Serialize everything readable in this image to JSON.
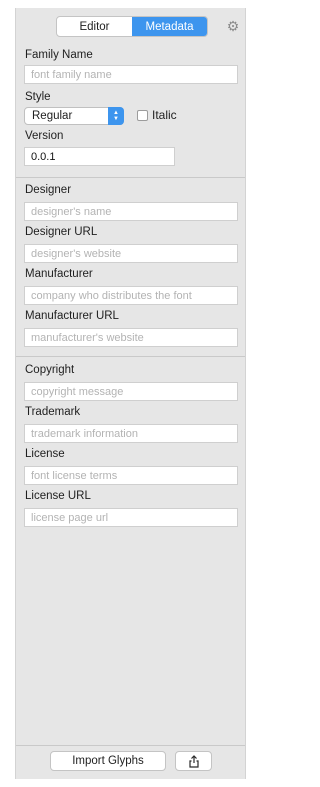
{
  "tabs": [
    {
      "label": "Editor",
      "active": false
    },
    {
      "label": "Metadata",
      "active": true
    }
  ],
  "icons": {
    "settings": "gear-icon",
    "export": "share-icon",
    "stepper": "chevron-updown-icon"
  },
  "colors": {
    "accent": "#3d95ee",
    "panel": "#e6e6e6"
  },
  "fields": {
    "family_name": {
      "label": "Family Name",
      "placeholder": "font family name"
    },
    "style": {
      "label": "Style",
      "value": "Regular",
      "italic_label": "Italic",
      "italic_checked": false
    },
    "version": {
      "label": "Version",
      "value": "0.0.1"
    },
    "designer": {
      "label": "Designer",
      "placeholder": "designer's name"
    },
    "designer_url": {
      "label": "Designer URL",
      "placeholder": "designer's website"
    },
    "manufacturer": {
      "label": "Manufacturer",
      "placeholder": "company who distributes the font"
    },
    "manufacturer_url": {
      "label": "Manufacturer URL",
      "placeholder": "manufacturer's website"
    },
    "copyright": {
      "label": "Copyright",
      "placeholder": "copyright message"
    },
    "trademark": {
      "label": "Trademark",
      "placeholder": "trademark information"
    },
    "license": {
      "label": "License",
      "placeholder": "font license terms"
    },
    "license_url": {
      "label": "License URL",
      "placeholder": "license page url"
    }
  },
  "footer": {
    "import_label": "Import Glyphs"
  }
}
